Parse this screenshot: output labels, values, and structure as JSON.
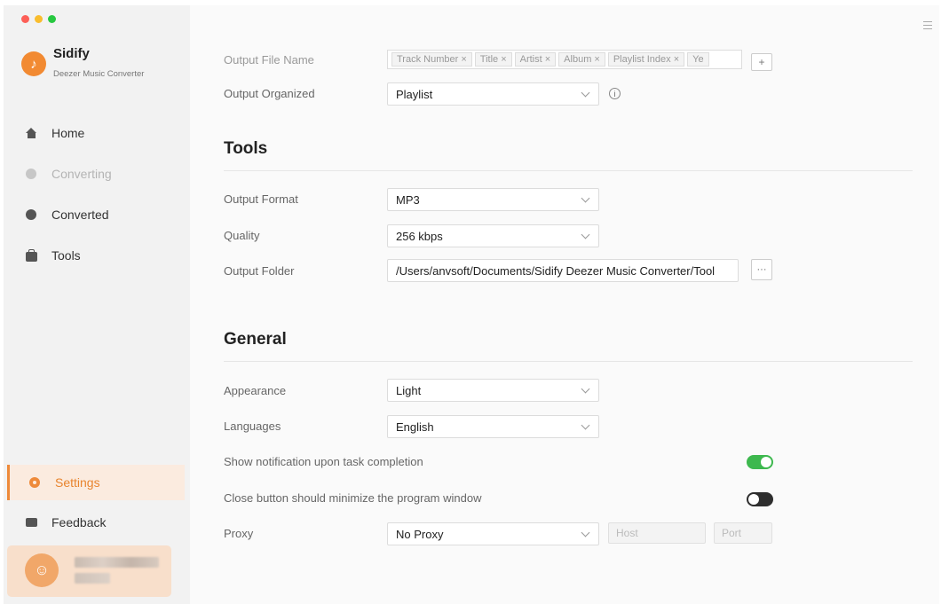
{
  "sidebar": {
    "app_name": "Sidify",
    "app_subtitle": "Deezer Music Converter",
    "logo_glyph": "♪",
    "items": [
      {
        "label": "Home",
        "icon": "home-icon"
      },
      {
        "label": "Converting",
        "icon": "converting-icon"
      },
      {
        "label": "Converted",
        "icon": "converted-icon"
      },
      {
        "label": "Tools",
        "icon": "toolbox-icon"
      },
      {
        "label": "Settings",
        "icon": "gear-icon"
      },
      {
        "label": "Feedback",
        "icon": "feedback-icon"
      }
    ],
    "active_item": "Settings",
    "accent_color": "#ee8a3a"
  },
  "main": {
    "partial_top": {
      "output_file_name_label": "Output File Name",
      "file_name_tags": [
        "Track Number ×",
        "Title ×",
        "Artist ×",
        "Album ×",
        "Playlist Index ×",
        "Ye"
      ],
      "add_tag_label": "+",
      "output_organized_label": "Output Organized",
      "output_organized_value": "Playlist"
    },
    "tools": {
      "title": "Tools",
      "output_format_label": "Output Format",
      "output_format_value": "MP3",
      "quality_label": "Quality",
      "quality_value": "256 kbps",
      "output_folder_label": "Output Folder",
      "output_folder_value": "/Users/anvsoft/Documents/Sidify Deezer Music Converter/Tool",
      "browse_label": "···"
    },
    "general": {
      "title": "General",
      "appearance_label": "Appearance",
      "appearance_value": "Light",
      "languages_label": "Languages",
      "languages_value": "English",
      "notification_label": "Show notification upon task completion",
      "notification_enabled": true,
      "close_minimize_label": "Close button should minimize the program window",
      "close_minimize_enabled": false,
      "proxy_label": "Proxy",
      "proxy_value": "No Proxy",
      "host_placeholder": "Host",
      "port_placeholder": "Port"
    }
  }
}
